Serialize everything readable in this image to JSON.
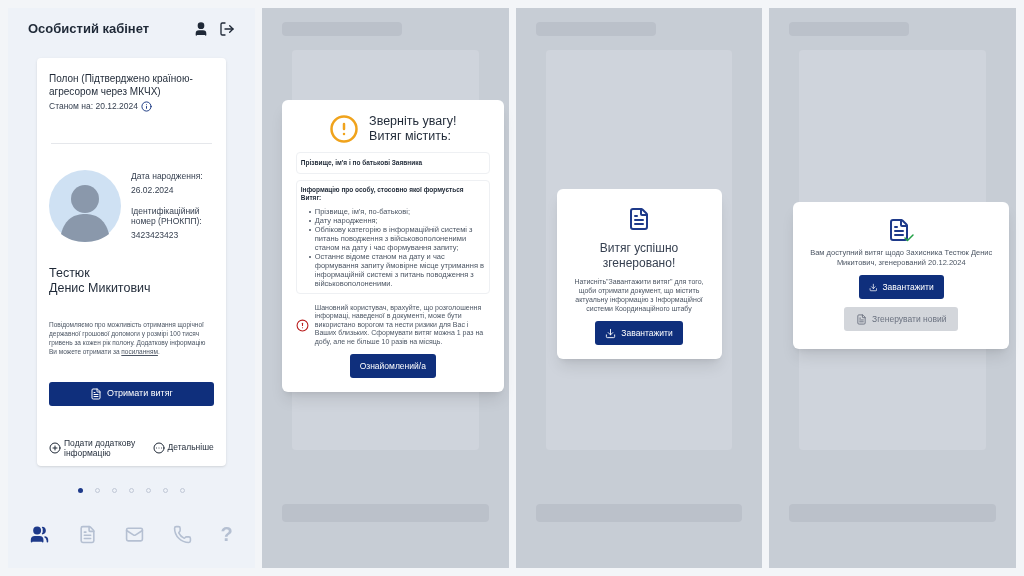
{
  "screens": [
    {
      "kind": "profile",
      "header": {
        "title": "Особистий кабінет"
      },
      "card": {
        "status": "Полон (Підтверджено країною-агресором через МКЧХ)",
        "as_of": "Станом на: 20.12.2024",
        "birth_label": "Дата народження:",
        "birth_date": "26.02.2024",
        "id_label": "Ідентифікаційний номер (РНОКПП):",
        "id_number": "3423423423",
        "name": "Тестюк\nДенис Микитович",
        "notice": {
          "text": "Повідомляємо про можливість отримання щорічної державної грошової допомоги у розмірі 100 тисяч гривень за кожен рік полону. Додаткову інформацію Ви можете отримати за ",
          "link": "посиланням",
          "end": "."
        },
        "primary_button": "Отримати витяг",
        "add_info_link": "Подати додаткову інформацію",
        "details_link": "Детальніше"
      },
      "pager": [
        {
          "selected": true
        },
        {
          "selected": false
        },
        {
          "selected": false
        },
        {
          "selected": false
        },
        {
          "selected": false
        },
        {
          "selected": false
        },
        {
          "selected": false
        }
      ],
      "nav": [
        {
          "selected": true
        },
        {
          "selected": false
        },
        {
          "selected": false
        },
        {
          "selected": false
        },
        {
          "selected": false,
          "label": "?"
        }
      ]
    },
    {
      "kind": "warning_modal",
      "title": "Зверніть увагу!\nВитяг містить:",
      "applicant": "Прізвище, ім'я і по батькові Заявника",
      "info_heading": "Інформацію про особу, стосовно якої формується Витяг:",
      "info_items": [
        "Прізвище, ім'я, по-батькові;",
        "Дату народження;",
        "Облікову категорію в інформаційній системі з питань поводження з військовополоненими станом на дату і час формування запиту;",
        "Останнє відоме станом на дату и час формування запиту ймовірне місце утримання в інформаційній системі з питань поводження з військовополоненими."
      ],
      "warning": "Шановний користувач, врахуйте, що розголошення інформаці, наведеної в документі, може бути використано ворогом та нести ризики для Вас і Ваших близьких. Сформувати витяг можна 1 раз на добу, але не більше 10 разів на місяць.",
      "buttons": [
        {
          "label": "Ознайомлений/а",
          "disabled": false
        }
      ]
    },
    {
      "kind": "success_modal",
      "title": "Витяг успішно згенеровано!",
      "message": "Натисніть\"Завантажити витяг\" для того, щоби отримати документ, що містить актуальну інформацію з Інформаційної системи Координаційного штабу",
      "buttons": [
        {
          "label": "Завантажити",
          "disabled": false
        }
      ]
    },
    {
      "kind": "ready_modal",
      "message": "Вам доступний витяг щодо Захисника Тестюк Денис Микитович, згенерований 20.12.2024",
      "buttons": [
        {
          "label": "Завантажити",
          "disabled": false
        },
        {
          "label": "Згенерувати новий",
          "disabled": true
        }
      ]
    }
  ]
}
